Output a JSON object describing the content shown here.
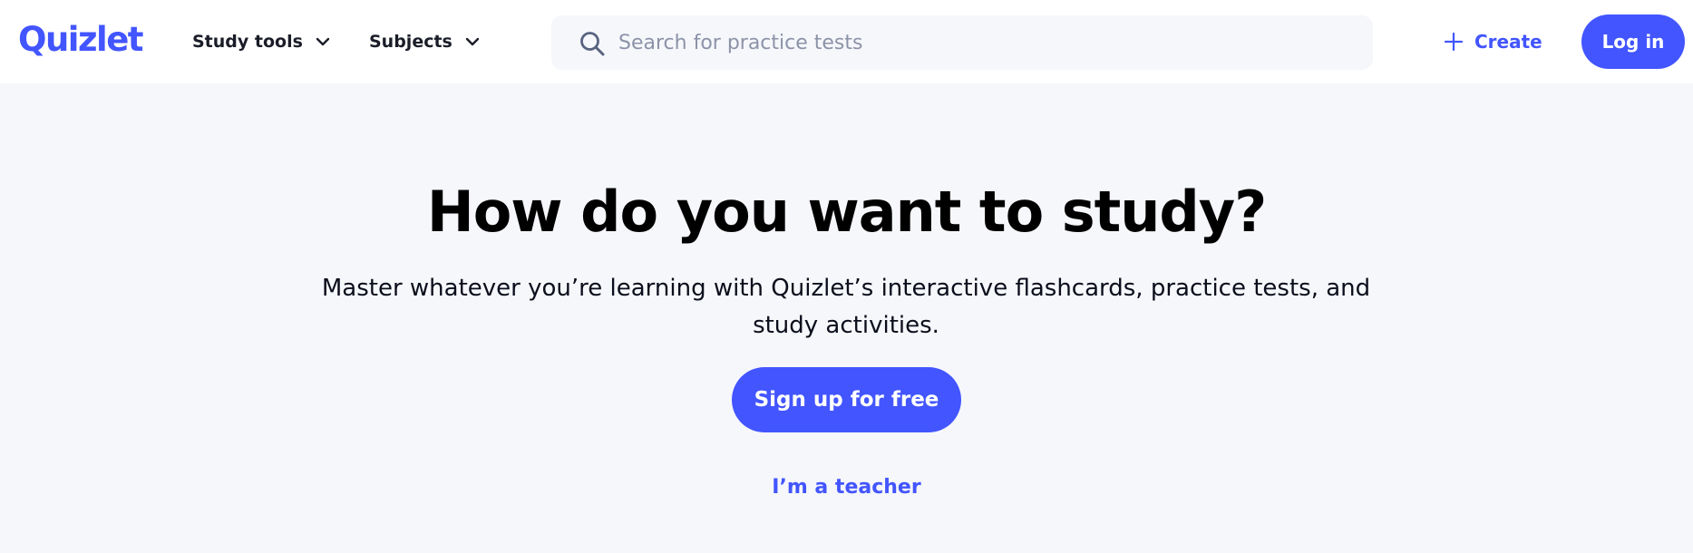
{
  "colors": {
    "brand": "#4255ff",
    "background": "#f6f7fb",
    "header": "#ffffff",
    "text": "#000000"
  },
  "header": {
    "logo": "Quizlet",
    "nav": [
      {
        "label": "Study tools",
        "icon": "chevron-down-icon"
      },
      {
        "label": "Subjects",
        "icon": "chevron-down-icon"
      }
    ],
    "search": {
      "placeholder": "Search for practice tests",
      "value": "",
      "icon": "search-icon"
    },
    "create": {
      "label": "Create",
      "icon": "plus-icon"
    },
    "login": {
      "label": "Log in"
    }
  },
  "hero": {
    "title": "How do you want to study?",
    "subtitle": "Master whatever you’re learning with Quizlet’s interactive flashcards, practice tests, and study activities.",
    "signup_label": "Sign up for free",
    "teacher_link": "I’m a teacher"
  }
}
